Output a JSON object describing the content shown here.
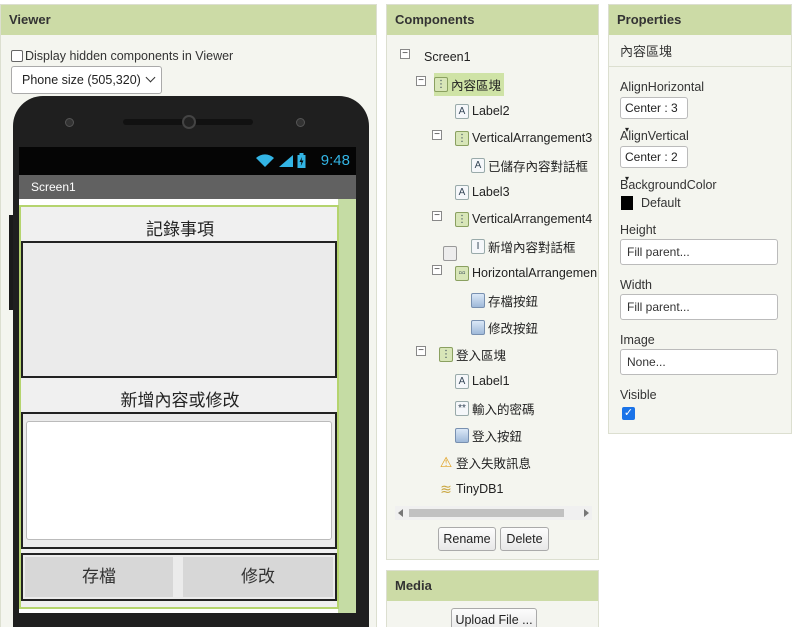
{
  "viewer": {
    "title": "Viewer",
    "hidden_label": "Display hidden components in Viewer",
    "size_select": "Phone size (505,320)",
    "status_time": "9:48",
    "screen_title": "Screen1",
    "record_label": "記錄事項",
    "add_label": "新增內容或修改",
    "save_button": "存檔",
    "edit_button": "修改"
  },
  "components": {
    "title": "Components",
    "tree": [
      {
        "label": "Screen1",
        "icon": "screen-icon"
      },
      {
        "label": "內容區塊",
        "icon": "vertical-arrangement-icon"
      },
      {
        "label": "Label2",
        "icon": "label-icon"
      },
      {
        "label": "VerticalArrangement3",
        "icon": "vertical-arrangement-icon"
      },
      {
        "label": "已儲存內容對話框",
        "icon": "label-icon"
      },
      {
        "label": "Label3",
        "icon": "label-icon"
      },
      {
        "label": "VerticalArrangement4",
        "icon": "vertical-arrangement-icon"
      },
      {
        "label": "新增內容對話框",
        "icon": "textbox-icon"
      },
      {
        "label": "HorizontalArrangemen",
        "icon": "horizontal-arrangement-icon"
      },
      {
        "label": "存檔按鈕",
        "icon": "button-icon"
      },
      {
        "label": "修改按鈕",
        "icon": "button-icon"
      },
      {
        "label": "登入區塊",
        "icon": "vertical-arrangement-icon"
      },
      {
        "label": "Label1",
        "icon": "label-icon"
      },
      {
        "label": "輸入的密碼",
        "icon": "password-icon"
      },
      {
        "label": "登入按鈕",
        "icon": "button-icon"
      },
      {
        "label": "登入失敗訊息",
        "icon": "notifier-icon"
      },
      {
        "label": "TinyDB1",
        "icon": "database-icon"
      }
    ],
    "rename_button": "Rename",
    "delete_button": "Delete"
  },
  "media": {
    "title": "Media",
    "upload_button": "Upload File ..."
  },
  "properties": {
    "title": "Properties",
    "component": "內容區塊",
    "align_horizontal_label": "AlignHorizontal",
    "align_horizontal_value": "Center : 3",
    "align_vertical_label": "AlignVertical",
    "align_vertical_value": "Center : 2",
    "background_color_label": "BackgroundColor",
    "background_color_value": "Default",
    "height_label": "Height",
    "height_value": "Fill parent...",
    "width_label": "Width",
    "width_value": "Fill parent...",
    "image_label": "Image",
    "image_value": "None...",
    "visible_label": "Visible",
    "visible_checked": true
  },
  "colors": {
    "header_green": "#ccdba6",
    "selection_green": "#cfe3a6",
    "arrangement_border": "#b5d46e",
    "status_time": "#33b5e5"
  }
}
